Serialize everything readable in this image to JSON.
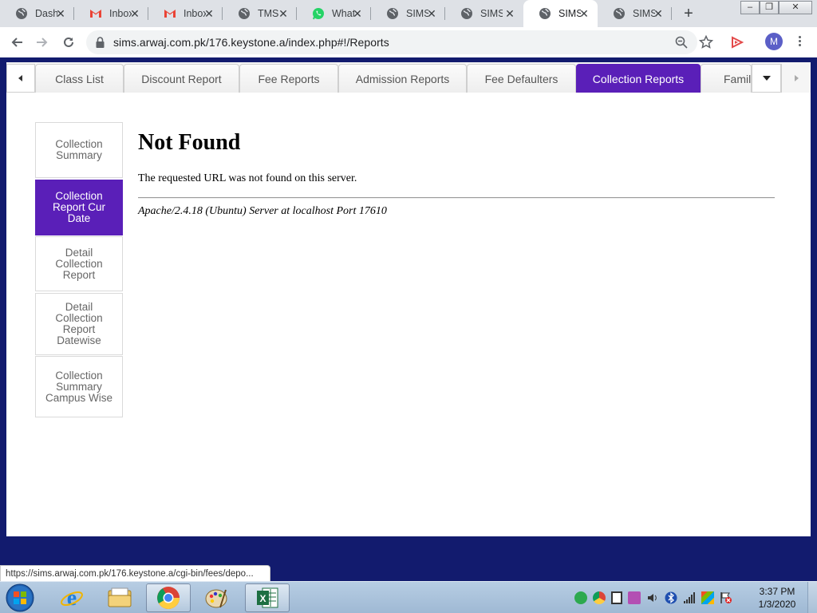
{
  "browser": {
    "tabs": [
      {
        "title": "Dashb",
        "icon": "globe-icon"
      },
      {
        "title": "Inbox",
        "icon": "gmail-icon"
      },
      {
        "title": "Inbox",
        "icon": "gmail-icon"
      },
      {
        "title": "TMS",
        "icon": "globe-icon"
      },
      {
        "title": "Whats",
        "icon": "whatsapp-icon"
      },
      {
        "title": "SIMS",
        "icon": "globe-icon"
      },
      {
        "title": "SIMS",
        "icon": "globe-icon"
      },
      {
        "title": "SIMS",
        "icon": "globe-icon",
        "active": true
      },
      {
        "title": "SIMS",
        "icon": "globe-icon"
      }
    ],
    "new_tab": "+",
    "url": "sims.arwaj.com.pk/176.keystone.a/index.php#!/Reports",
    "profile_initial": "M",
    "window_buttons": {
      "minimize": "–",
      "restore": "❐",
      "close": "✕"
    }
  },
  "report_tabs": [
    {
      "label": "Class List"
    },
    {
      "label": "Discount Report"
    },
    {
      "label": "Fee Reports"
    },
    {
      "label": "Admission Reports"
    },
    {
      "label": "Fee Defaulters"
    },
    {
      "label": "Collection Reports",
      "active": true
    },
    {
      "label": "Family"
    }
  ],
  "submenu": [
    {
      "label": "Collection Summary"
    },
    {
      "label": "Collection Report Cur Date",
      "active": true
    },
    {
      "label": "Detail Collection Report"
    },
    {
      "label": "Detail Collection Report Datewise"
    },
    {
      "label": "Collection Summary Campus Wise"
    }
  ],
  "not_found": {
    "title": "Not Found",
    "message": "The requested URL was not found on this server.",
    "address": "Apache/2.4.18 (Ubuntu) Server at localhost Port 17610"
  },
  "status_url": "https://sims.arwaj.com.pk/176.keystone.a/cgi-bin/fees/depo...",
  "taskbar": {
    "time": "3:37 PM",
    "date": "1/3/2020"
  },
  "colors": {
    "accent": "#5a1fb8",
    "page_bg": "#121b6e"
  }
}
